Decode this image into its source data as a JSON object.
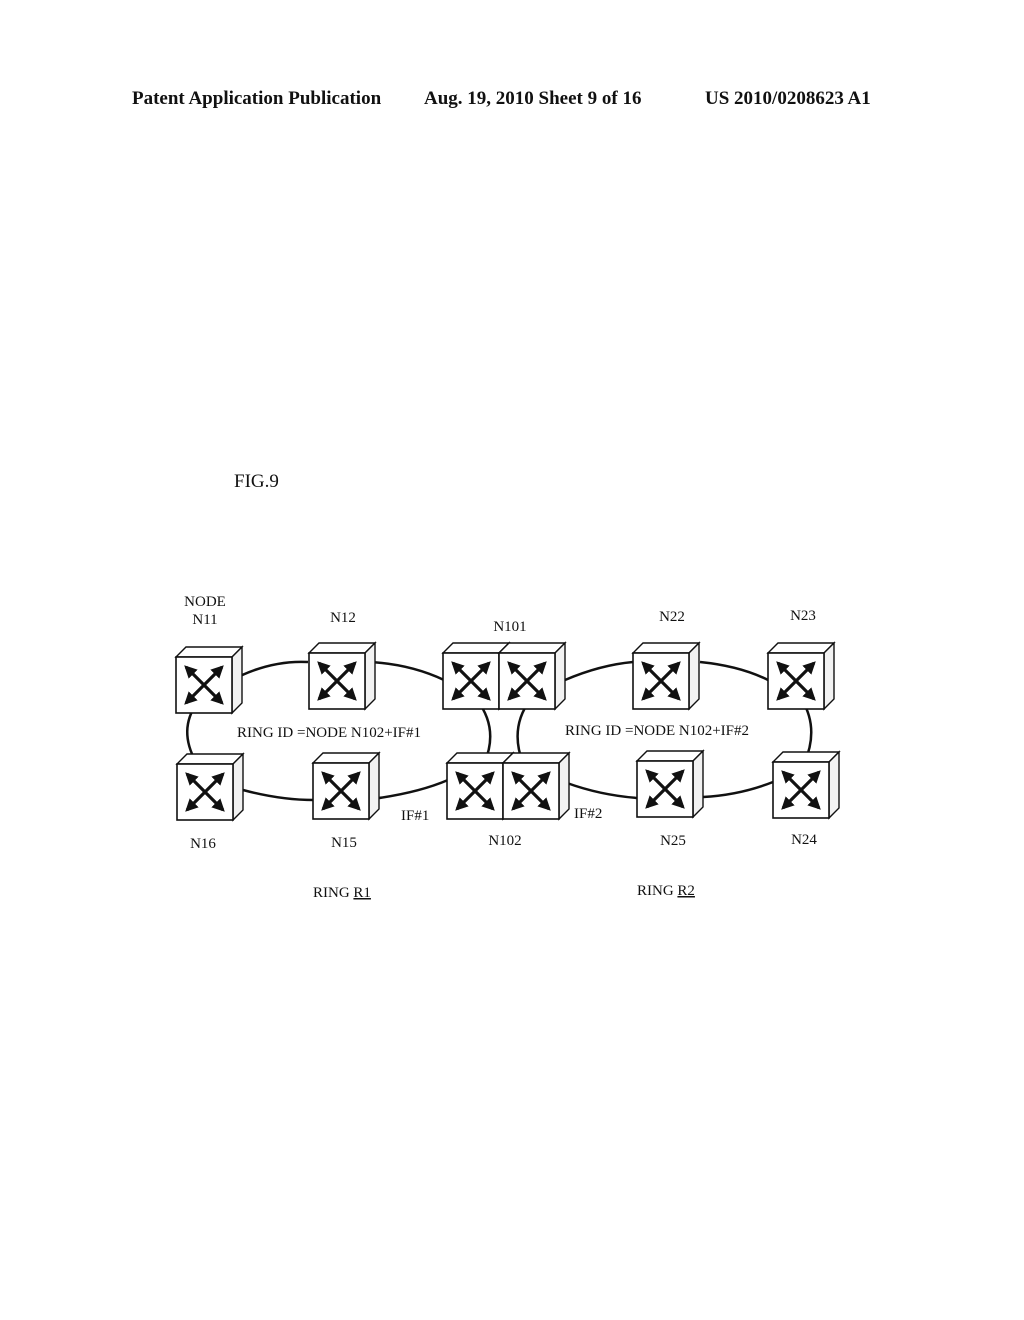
{
  "header": {
    "publication": "Patent Application Publication",
    "date_sheet": "Aug. 19, 2010  Sheet 9 of 16",
    "number": "US 2010/0208623 A1"
  },
  "figure": {
    "label": "FIG.9",
    "nodes": [
      {
        "id": "N11",
        "label_line1": "NODE",
        "label_line2": "N11"
      },
      {
        "id": "N12",
        "label": "N12"
      },
      {
        "id": "N101",
        "label": "N101"
      },
      {
        "id": "N22",
        "label": "N22"
      },
      {
        "id": "N23",
        "label": "N23"
      },
      {
        "id": "N16",
        "label": "N16"
      },
      {
        "id": "N15",
        "label": "N15"
      },
      {
        "id": "N102",
        "label": "N102"
      },
      {
        "id": "N25",
        "label": "N25"
      },
      {
        "id": "N24",
        "label": "N24"
      }
    ],
    "ring_r1": {
      "id_text": "RING ID =NODE N102+IF#1",
      "name_prefix": "RING ",
      "name": "R1"
    },
    "ring_r2": {
      "id_text": "RING ID =NODE N102+IF#2",
      "name_prefix": "RING ",
      "name": "R2"
    },
    "interfaces": {
      "if1": "IF#1",
      "if2": "IF#2"
    },
    "node_icon": "switch-cross-arrows-icon"
  }
}
